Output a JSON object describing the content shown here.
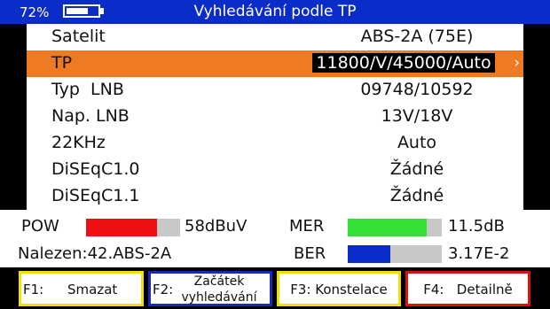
{
  "header": {
    "battery_percent_text": "72%",
    "battery_level": 0.72,
    "title": "Vyhledávání podle TP"
  },
  "settings": {
    "rows": [
      {
        "label": "Satelit",
        "value": "ABS-2A (75E)"
      },
      {
        "label": "TP",
        "value": "11800/V/45000/Auto"
      },
      {
        "label": "Typ  LNB",
        "value": "09748/10592"
      },
      {
        "label": "Nap. LNB",
        "value": "13V/18V"
      },
      {
        "label": "22KHz",
        "value": "Auto"
      },
      {
        "label": "DiSEqC1.0",
        "value": "Žádné"
      },
      {
        "label": "DiSEqC1.1",
        "value": "Žádné"
      }
    ],
    "selected_arrow": "›"
  },
  "signal": {
    "pow_label": "POW",
    "pow_value": "58dBuV",
    "pow_level": 0.75,
    "mer_label": "MER",
    "mer_value": "11.5dB",
    "mer_level": 0.84,
    "ber_label": "BER",
    "ber_value": "3.17E-2",
    "ber_level": 0.45,
    "found_text": "Nalezen:42.ABS-2A"
  },
  "colors": {
    "header_bg": "#0a2cc8",
    "selected_row": "#ef7a24",
    "pow_fill": "#ee1010",
    "mer_fill": "#33e033",
    "ber_fill": "#0a2cc8",
    "f1_border": "#f2e000",
    "f2_border": "#1a2ab8",
    "f3_border": "#f2e000",
    "f4_border": "#e01010"
  },
  "function_keys": {
    "f1": {
      "key": "F1:",
      "label": "Smazat"
    },
    "f2": {
      "key": "F2:",
      "label_line1": "Začátek",
      "label_line2": "vyhledávání"
    },
    "f3": {
      "label": "F3: Konstelace"
    },
    "f4": {
      "label": "F4:   Detailně"
    }
  }
}
